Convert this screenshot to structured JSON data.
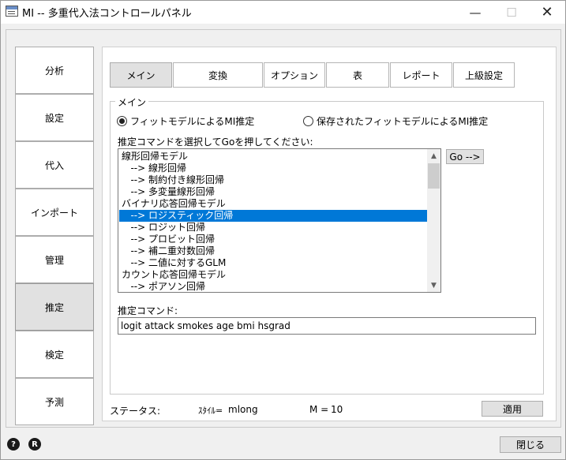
{
  "window": {
    "title": "MI -- 多重代入法コントロールパネル",
    "minimize_icon": "—",
    "maximize_icon": "☐",
    "close_icon": "✕"
  },
  "sidebar": {
    "items": [
      {
        "label": "分析"
      },
      {
        "label": "設定"
      },
      {
        "label": "代入"
      },
      {
        "label": "インポート"
      },
      {
        "label": "管理"
      },
      {
        "label": "推定"
      },
      {
        "label": "検定"
      },
      {
        "label": "予測"
      }
    ]
  },
  "tabs": [
    {
      "label": "メイン"
    },
    {
      "label": "変換"
    },
    {
      "label": "オプション"
    },
    {
      "label": "表"
    },
    {
      "label": "レポート"
    },
    {
      "label": "上級設定"
    }
  ],
  "main": {
    "group_title": "メイン",
    "radio_fit": "フィットモデルによるMI推定",
    "radio_saved": "保存されたフィットモデルによるMI推定",
    "list_prompt": "推定コマンドを選択してGoを押してください:",
    "list_items": [
      "線形回帰モデル",
      "   --> 線形回帰",
      "   --> 制約付き線形回帰",
      "   --> 多変量線形回帰",
      "バイナリ応答回帰モデル",
      "   --> ロジスティック回帰",
      "   --> ロジット回帰",
      "   --> プロビット回帰",
      "   --> 補二重対数回帰",
      "   --> 二値に対するGLM",
      "カウント応答回帰モデル",
      "   --> ポアソン回帰"
    ],
    "selected_index": 5,
    "go_button": "Go -->",
    "scroll_up": "▲",
    "scroll_down": "▼",
    "command_label": "推定コマンド:",
    "command_value": "logit attack smokes age bmi hsgrad"
  },
  "status": {
    "label": "ステータス:",
    "style_label": "ｽﾀｲﾙ=",
    "style_value": "mlong",
    "m_label": "M =",
    "m_value": "10",
    "apply_button": "適用"
  },
  "footer": {
    "help_icon": "?",
    "r_icon": "R",
    "close_button": "閉じる"
  }
}
